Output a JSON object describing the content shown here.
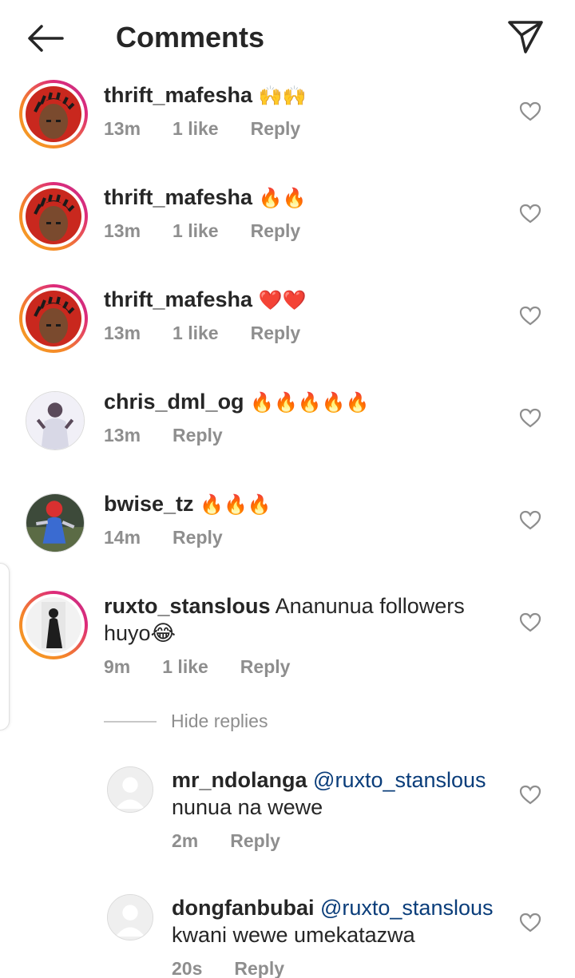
{
  "header": {
    "title": "Comments"
  },
  "comments": [
    {
      "username": "thrift_mafesha",
      "text": "🙌🙌",
      "time": "13m",
      "likes": "1 like",
      "reply": "Reply"
    },
    {
      "username": "thrift_mafesha",
      "text": "🔥🔥",
      "time": "13m",
      "likes": "1 like",
      "reply": "Reply"
    },
    {
      "username": "thrift_mafesha",
      "text": "❤️❤️",
      "time": "13m",
      "likes": "1 like",
      "reply": "Reply"
    },
    {
      "username": "chris_dml_og",
      "text": "🔥🔥🔥🔥🔥",
      "time": "13m",
      "reply": "Reply"
    },
    {
      "username": "bwise_tz",
      "text": "🔥🔥🔥",
      "time": "14m",
      "reply": "Reply"
    },
    {
      "username": "ruxto_stanslous",
      "text_line1": "Ananunua followers",
      "text_line2": "huyo😂",
      "time": "9m",
      "likes": "1 like",
      "reply": "Reply"
    }
  ],
  "hide_replies": "Hide replies",
  "replies": [
    {
      "username": "mr_ndolanga",
      "mention": "@ruxto_stanslous",
      "text": "nunua na wewe",
      "time": "2m",
      "reply": "Reply"
    },
    {
      "username": "dongfanbubai",
      "mention": "@ruxto_stanslous",
      "text": "kwani wewe umekatazwa",
      "time": "20s",
      "reply": "Reply"
    }
  ],
  "icons": {
    "back": "arrow-left-icon",
    "send": "paper-plane-icon",
    "like": "heart-outline-icon"
  }
}
